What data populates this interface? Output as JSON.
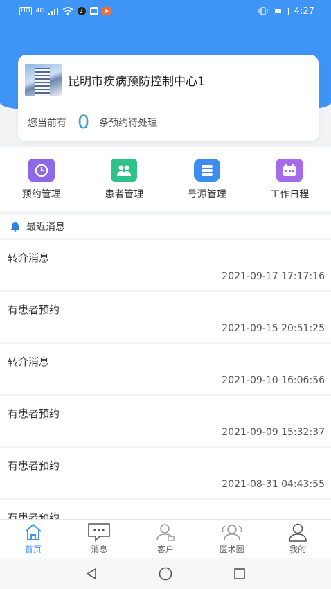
{
  "statusbar": {
    "time": "4:27",
    "carrier_badge": "HD",
    "signal": "4G"
  },
  "org": {
    "name": "昆明市疾病预防控制中心1"
  },
  "pending": {
    "prefix": "您当前有",
    "count": "0",
    "suffix": "条预约待处理"
  },
  "shortcuts": [
    {
      "label": "预约管理",
      "icon": "clock-icon",
      "color": "#8f68e6"
    },
    {
      "label": "患者管理",
      "icon": "patients-icon",
      "color": "#2fc18a"
    },
    {
      "label": "号源管理",
      "icon": "list-icon",
      "color": "#3b8ef0"
    },
    {
      "label": "工作日程",
      "icon": "calendar-icon",
      "color": "#a56be8"
    }
  ],
  "recent": {
    "title": "最近消息"
  },
  "messages": [
    {
      "title": "转介消息",
      "time": "2021-09-17 17:17:16"
    },
    {
      "title": "有患者预约",
      "time": "2021-09-15 20:51:25"
    },
    {
      "title": "转介消息",
      "time": "2021-09-10 16:06:56"
    },
    {
      "title": "有患者预约",
      "time": "2021-09-09 15:32:37"
    },
    {
      "title": "有患者预约",
      "time": "2021-08-31 04:43:55"
    },
    {
      "title": "有患者预约",
      "time": ""
    }
  ],
  "tabs": [
    {
      "label": "首页",
      "active": true
    },
    {
      "label": "消息",
      "active": false
    },
    {
      "label": "客户",
      "active": false
    },
    {
      "label": "医术圈",
      "active": false
    },
    {
      "label": "我的",
      "active": false
    }
  ],
  "colors": {
    "primary": "#3f95f6",
    "count": "#3aa0c8"
  }
}
